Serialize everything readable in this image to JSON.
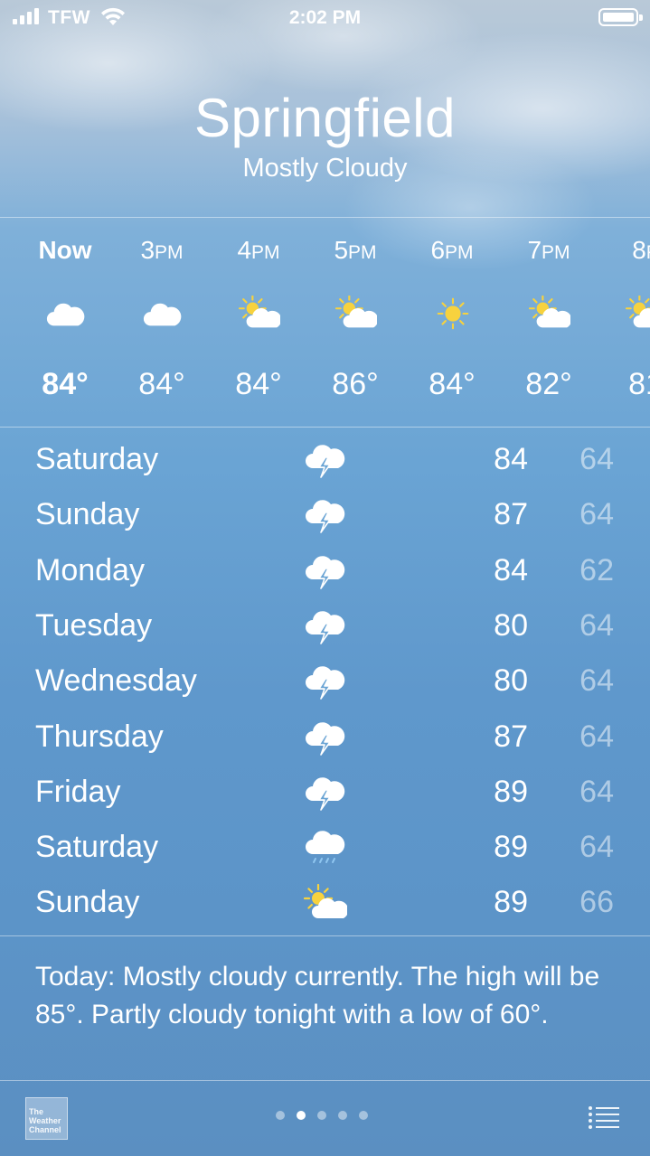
{
  "status_bar": {
    "carrier": "TFW",
    "time": "2:02 PM"
  },
  "location": {
    "city": "Springfield",
    "condition": "Mostly Cloudy"
  },
  "hourly": [
    {
      "time": "Now",
      "suffix": "",
      "icon": "cloud-icon",
      "temp": "84°"
    },
    {
      "time": "3",
      "suffix": "PM",
      "icon": "cloud-icon",
      "temp": "84°"
    },
    {
      "time": "4",
      "suffix": "PM",
      "icon": "partly-sunny-icon",
      "temp": "84°"
    },
    {
      "time": "5",
      "suffix": "PM",
      "icon": "partly-sunny-icon",
      "temp": "86°"
    },
    {
      "time": "6",
      "suffix": "PM",
      "icon": "sun-icon",
      "temp": "84°"
    },
    {
      "time": "7",
      "suffix": "PM",
      "icon": "partly-sunny-icon",
      "temp": "82°"
    },
    {
      "time": "8",
      "suffix": "P",
      "icon": "partly-sunny-icon",
      "temp": "81"
    }
  ],
  "daily": [
    {
      "day": "Saturday",
      "icon": "thunderstorm-icon",
      "high": "84",
      "low": "64"
    },
    {
      "day": "Sunday",
      "icon": "thunderstorm-icon",
      "high": "87",
      "low": "64"
    },
    {
      "day": "Monday",
      "icon": "thunderstorm-icon",
      "high": "84",
      "low": "62"
    },
    {
      "day": "Tuesday",
      "icon": "thunderstorm-icon",
      "high": "80",
      "low": "64"
    },
    {
      "day": "Wednesday",
      "icon": "thunderstorm-icon",
      "high": "80",
      "low": "64"
    },
    {
      "day": "Thursday",
      "icon": "thunderstorm-icon",
      "high": "87",
      "low": "64"
    },
    {
      "day": "Friday",
      "icon": "thunderstorm-icon",
      "high": "89",
      "low": "64"
    },
    {
      "day": "Saturday",
      "icon": "rain-icon",
      "high": "89",
      "low": "64"
    },
    {
      "day": "Sunday",
      "icon": "partly-sunny-icon",
      "high": "89",
      "low": "66"
    }
  ],
  "summary": "Today: Mostly cloudy currently. The high will be 85°. Partly cloudy tonight with a low of 60°.",
  "footer": {
    "logo_text": [
      "The",
      "Weather",
      "Channel"
    ],
    "page_count": 5,
    "active_page": 1
  }
}
